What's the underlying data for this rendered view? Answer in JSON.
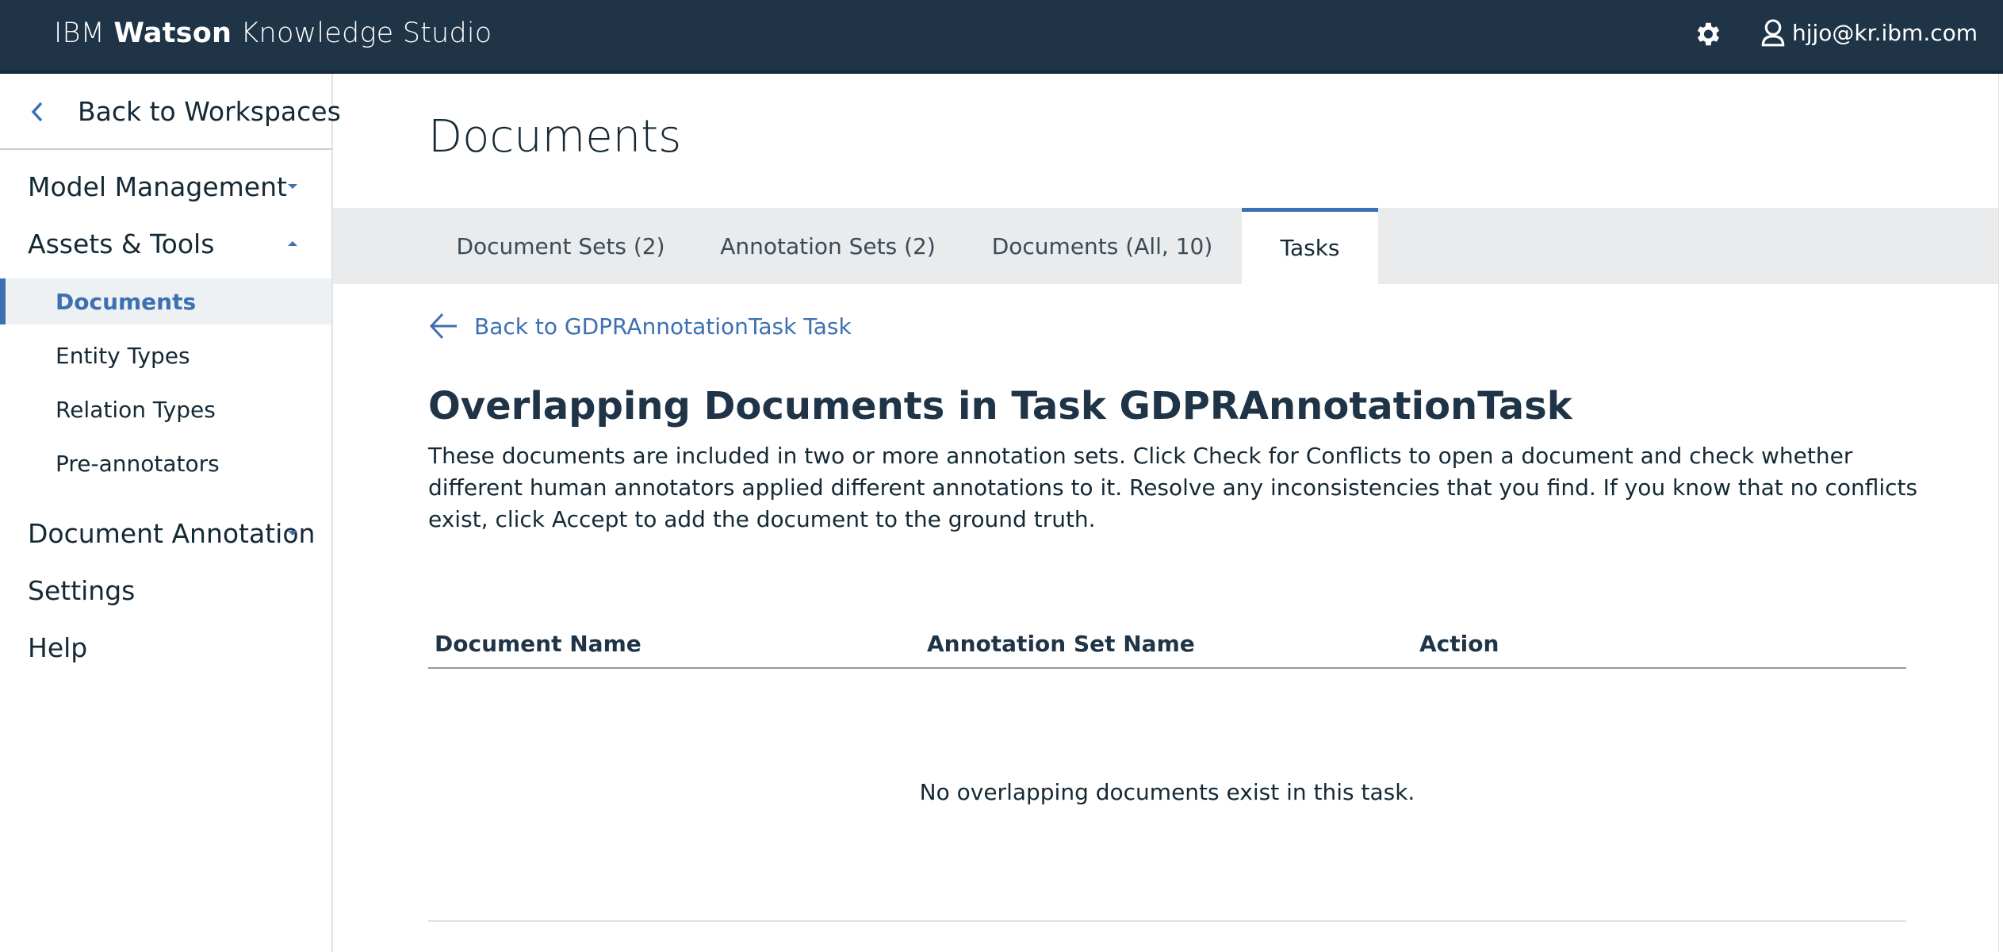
{
  "header": {
    "brand_prefix": "IBM",
    "brand_bold": "Watson",
    "brand_suffix": "Knowledge Studio",
    "settings_icon": "gear-icon",
    "user_icon": "user-icon",
    "user_email": "hjjo@kr.ibm.com"
  },
  "sidebar": {
    "back_label": "Back to Workspaces",
    "model_management": "Model Management",
    "assets_tools": "Assets & Tools",
    "items": [
      {
        "label": "Documents",
        "active": true
      },
      {
        "label": "Entity Types"
      },
      {
        "label": "Relation Types"
      },
      {
        "label": "Pre-annotators"
      }
    ],
    "document_annotation": "Document Annotation",
    "settings": "Settings",
    "help": "Help"
  },
  "main": {
    "page_title": "Documents",
    "tabs": [
      {
        "label": "Document Sets (2)"
      },
      {
        "label": "Annotation Sets (2)"
      },
      {
        "label": "Documents (All, 10)"
      },
      {
        "label": "Tasks",
        "active": true
      }
    ],
    "back_task": "Back to GDPRAnnotationTask Task",
    "section_title": "Overlapping Documents in Task GDPRAnnotationTask",
    "description": "These documents are included in two or more annotation sets. Click Check for Conflicts to open a document and check whether different human annotators applied different annotations to it. Resolve any inconsistencies that you find. If you know that no conflicts exist, click Accept to add the document to the ground truth.",
    "table": {
      "columns": [
        "Document Name",
        "Annotation Set Name",
        "Action"
      ],
      "empty_message": "No overlapping documents exist in this task."
    }
  },
  "colors": {
    "header_bg": "#1f3447",
    "accent": "#3d70b2",
    "tabbar_bg": "#e9ebed"
  }
}
